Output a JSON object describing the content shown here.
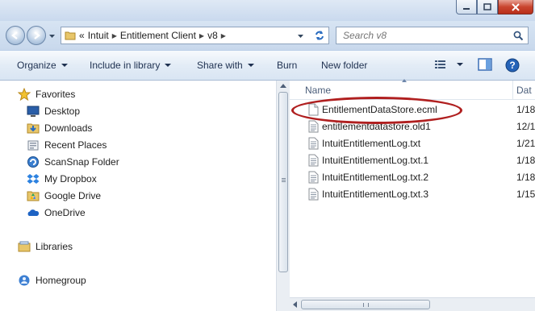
{
  "titlebar": {
    "minimize_icon": "minimize-icon",
    "maximize_icon": "maximize-icon",
    "close_icon": "close-icon"
  },
  "address": {
    "overflow": "«",
    "crumbs": [
      "Intuit",
      "Entitlement Client",
      "v8"
    ],
    "search_placeholder": "Search v8"
  },
  "toolbar": {
    "organize": "Organize",
    "include_in_library": "Include in library",
    "share_with": "Share with",
    "burn": "Burn",
    "new_folder": "New folder"
  },
  "nav": {
    "favorites_label": "Favorites",
    "favorites": [
      "Desktop",
      "Downloads",
      "Recent Places",
      "ScanSnap Folder",
      "My Dropbox",
      "Google Drive",
      "OneDrive"
    ],
    "libraries_label": "Libraries",
    "homegroup_label": "Homegroup"
  },
  "files": {
    "name_header": "Name",
    "date_header": "Dat",
    "rows": [
      {
        "name": "EntitlementDataStore.ecml",
        "date": "1/18",
        "icon": "blank-file-icon"
      },
      {
        "name": "entitlementdatastore.old1",
        "date": "12/1",
        "icon": "text-file-icon"
      },
      {
        "name": "IntuitEntitlementLog.txt",
        "date": "1/21",
        "icon": "text-file-icon"
      },
      {
        "name": "IntuitEntitlementLog.txt.1",
        "date": "1/18",
        "icon": "text-file-icon"
      },
      {
        "name": "IntuitEntitlementLog.txt.2",
        "date": "1/18",
        "icon": "text-file-icon"
      },
      {
        "name": "IntuitEntitlementLog.txt.3",
        "date": "1/15",
        "icon": "text-file-icon"
      }
    ]
  },
  "colors": {
    "highlight": "#b01f1f",
    "accent": "#1e3050"
  }
}
